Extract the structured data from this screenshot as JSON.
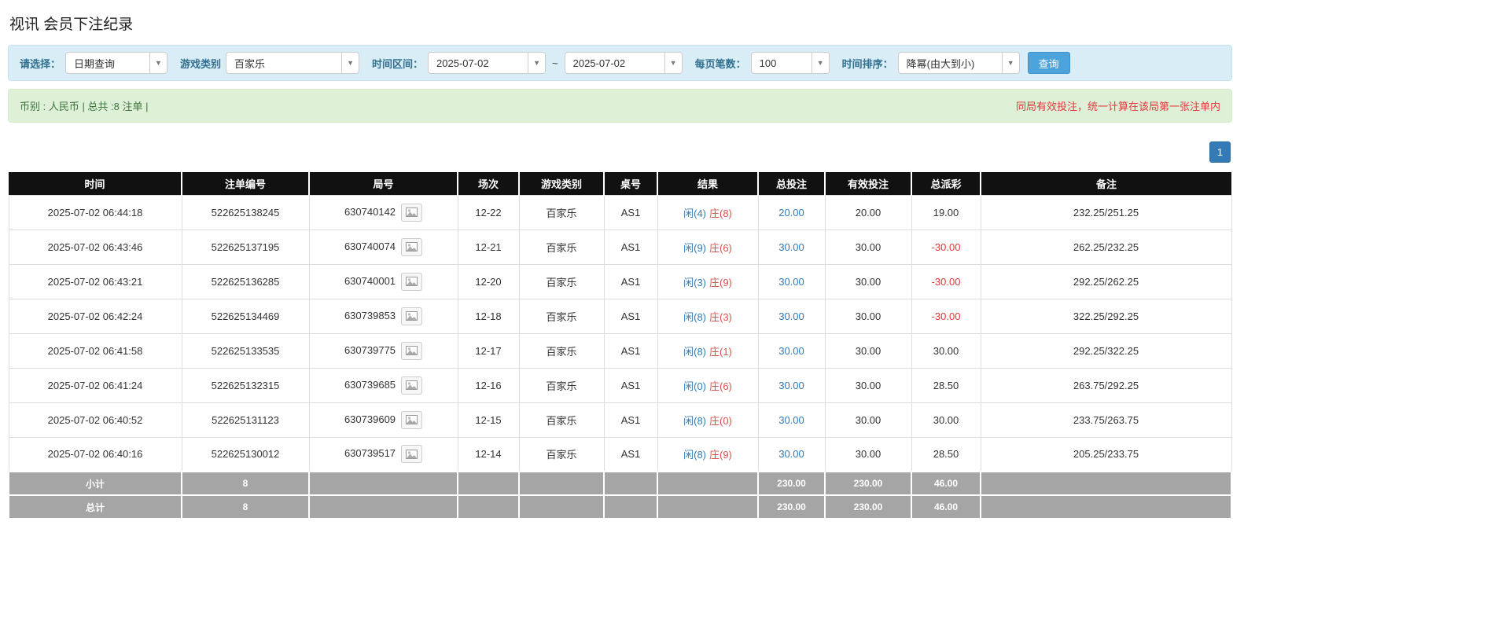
{
  "page": {
    "title": "视讯 会员下注纪录"
  },
  "filters": {
    "select_label": "请选择：",
    "select_value": "日期查询",
    "game_type_label": "游戏类别",
    "game_type_value": "百家乐",
    "time_range_label": "时间区间：",
    "date_from": "2025-07-02",
    "tilde": "~",
    "date_to": "2025-07-02",
    "page_size_label": "每页笔数：",
    "page_size_value": "100",
    "sort_label": "时间排序：",
    "sort_value": "降幂(由大到小)",
    "search_button": "查询",
    "caret": "▼"
  },
  "info_bar": {
    "left": "币别 : 人民币 | 总共 :8 注单 |",
    "right": "同局有效投注，统一计算在该局第一张注单内"
  },
  "pagination": {
    "current": "1"
  },
  "colors": {
    "accent_blue": "#337ab7",
    "result_red": "#d9534f",
    "negative_red": "#e4393c",
    "header_black": "#111111",
    "footer_gray": "#a5a5a5",
    "filter_bg": "#d9edf7",
    "info_bg": "#dff0d8"
  },
  "table": {
    "headers": [
      "时间",
      "注单编号",
      "局号",
      "场次",
      "游戏类别",
      "桌号",
      "结果",
      "总投注",
      "有效投注",
      "总派彩",
      "备注"
    ],
    "rows": [
      {
        "time": "2025-07-02 06:44:18",
        "bet_no": "522625138245",
        "round": "630740142",
        "session": "12-22",
        "game": "百家乐",
        "table": "AS1",
        "player": "闲(4)",
        "banker": "庄(8)",
        "total_bet": "20.00",
        "valid_bet": "20.00",
        "payout": "19.00",
        "payout_neg": false,
        "remark": "232.25/251.25"
      },
      {
        "time": "2025-07-02 06:43:46",
        "bet_no": "522625137195",
        "round": "630740074",
        "session": "12-21",
        "game": "百家乐",
        "table": "AS1",
        "player": "闲(9)",
        "banker": "庄(6)",
        "total_bet": "30.00",
        "valid_bet": "30.00",
        "payout": "-30.00",
        "payout_neg": true,
        "remark": "262.25/232.25"
      },
      {
        "time": "2025-07-02 06:43:21",
        "bet_no": "522625136285",
        "round": "630740001",
        "session": "12-20",
        "game": "百家乐",
        "table": "AS1",
        "player": "闲(3)",
        "banker": "庄(9)",
        "total_bet": "30.00",
        "valid_bet": "30.00",
        "payout": "-30.00",
        "payout_neg": true,
        "remark": "292.25/262.25"
      },
      {
        "time": "2025-07-02 06:42:24",
        "bet_no": "522625134469",
        "round": "630739853",
        "session": "12-18",
        "game": "百家乐",
        "table": "AS1",
        "player": "闲(8)",
        "banker": "庄(3)",
        "total_bet": "30.00",
        "valid_bet": "30.00",
        "payout": "-30.00",
        "payout_neg": true,
        "remark": "322.25/292.25"
      },
      {
        "time": "2025-07-02 06:41:58",
        "bet_no": "522625133535",
        "round": "630739775",
        "session": "12-17",
        "game": "百家乐",
        "table": "AS1",
        "player": "闲(8)",
        "banker": "庄(1)",
        "total_bet": "30.00",
        "valid_bet": "30.00",
        "payout": "30.00",
        "payout_neg": false,
        "remark": "292.25/322.25"
      },
      {
        "time": "2025-07-02 06:41:24",
        "bet_no": "522625132315",
        "round": "630739685",
        "session": "12-16",
        "game": "百家乐",
        "table": "AS1",
        "player": "闲(0)",
        "banker": "庄(6)",
        "total_bet": "30.00",
        "valid_bet": "30.00",
        "payout": "28.50",
        "payout_neg": false,
        "remark": "263.75/292.25"
      },
      {
        "time": "2025-07-02 06:40:52",
        "bet_no": "522625131123",
        "round": "630739609",
        "session": "12-15",
        "game": "百家乐",
        "table": "AS1",
        "player": "闲(8)",
        "banker": "庄(0)",
        "total_bet": "30.00",
        "valid_bet": "30.00",
        "payout": "30.00",
        "payout_neg": false,
        "remark": "233.75/263.75"
      },
      {
        "time": "2025-07-02 06:40:16",
        "bet_no": "522625130012",
        "round": "630739517",
        "session": "12-14",
        "game": "百家乐",
        "table": "AS1",
        "player": "闲(8)",
        "banker": "庄(9)",
        "total_bet": "30.00",
        "valid_bet": "30.00",
        "payout": "28.50",
        "payout_neg": false,
        "remark": "205.25/233.75"
      }
    ],
    "footer": [
      {
        "label": "小计",
        "count": "8",
        "total_bet": "230.00",
        "valid_bet": "230.00",
        "payout": "46.00"
      },
      {
        "label": "总计",
        "count": "8",
        "total_bet": "230.00",
        "valid_bet": "230.00",
        "payout": "46.00"
      }
    ]
  }
}
